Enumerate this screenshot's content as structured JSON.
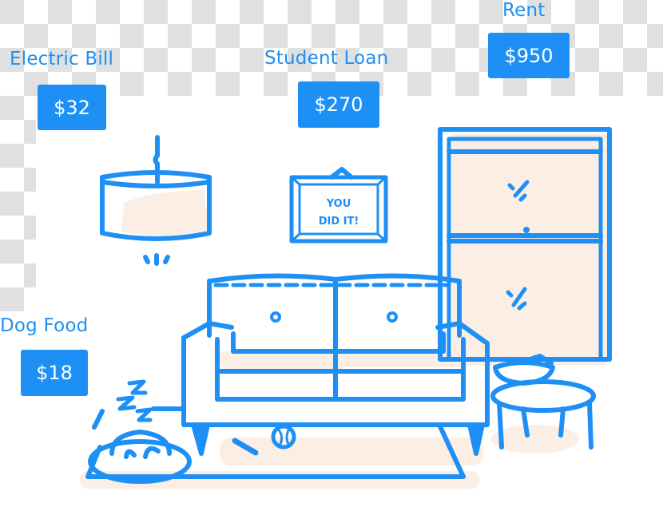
{
  "expenses": [
    {
      "label": "Electric Bill",
      "amount": "$32"
    },
    {
      "label": "Student Loan",
      "amount": "$270"
    },
    {
      "label": "Rent",
      "amount": "$950"
    },
    {
      "label": "Dog Food",
      "amount": "$18"
    }
  ],
  "picture_frame": {
    "line1": "YOU",
    "line2": "DID IT!"
  },
  "colors": {
    "accent": "#1e90f5",
    "label": "#1e90f0",
    "shadow": "#fbeee4",
    "checker": "#e0e0e0"
  }
}
